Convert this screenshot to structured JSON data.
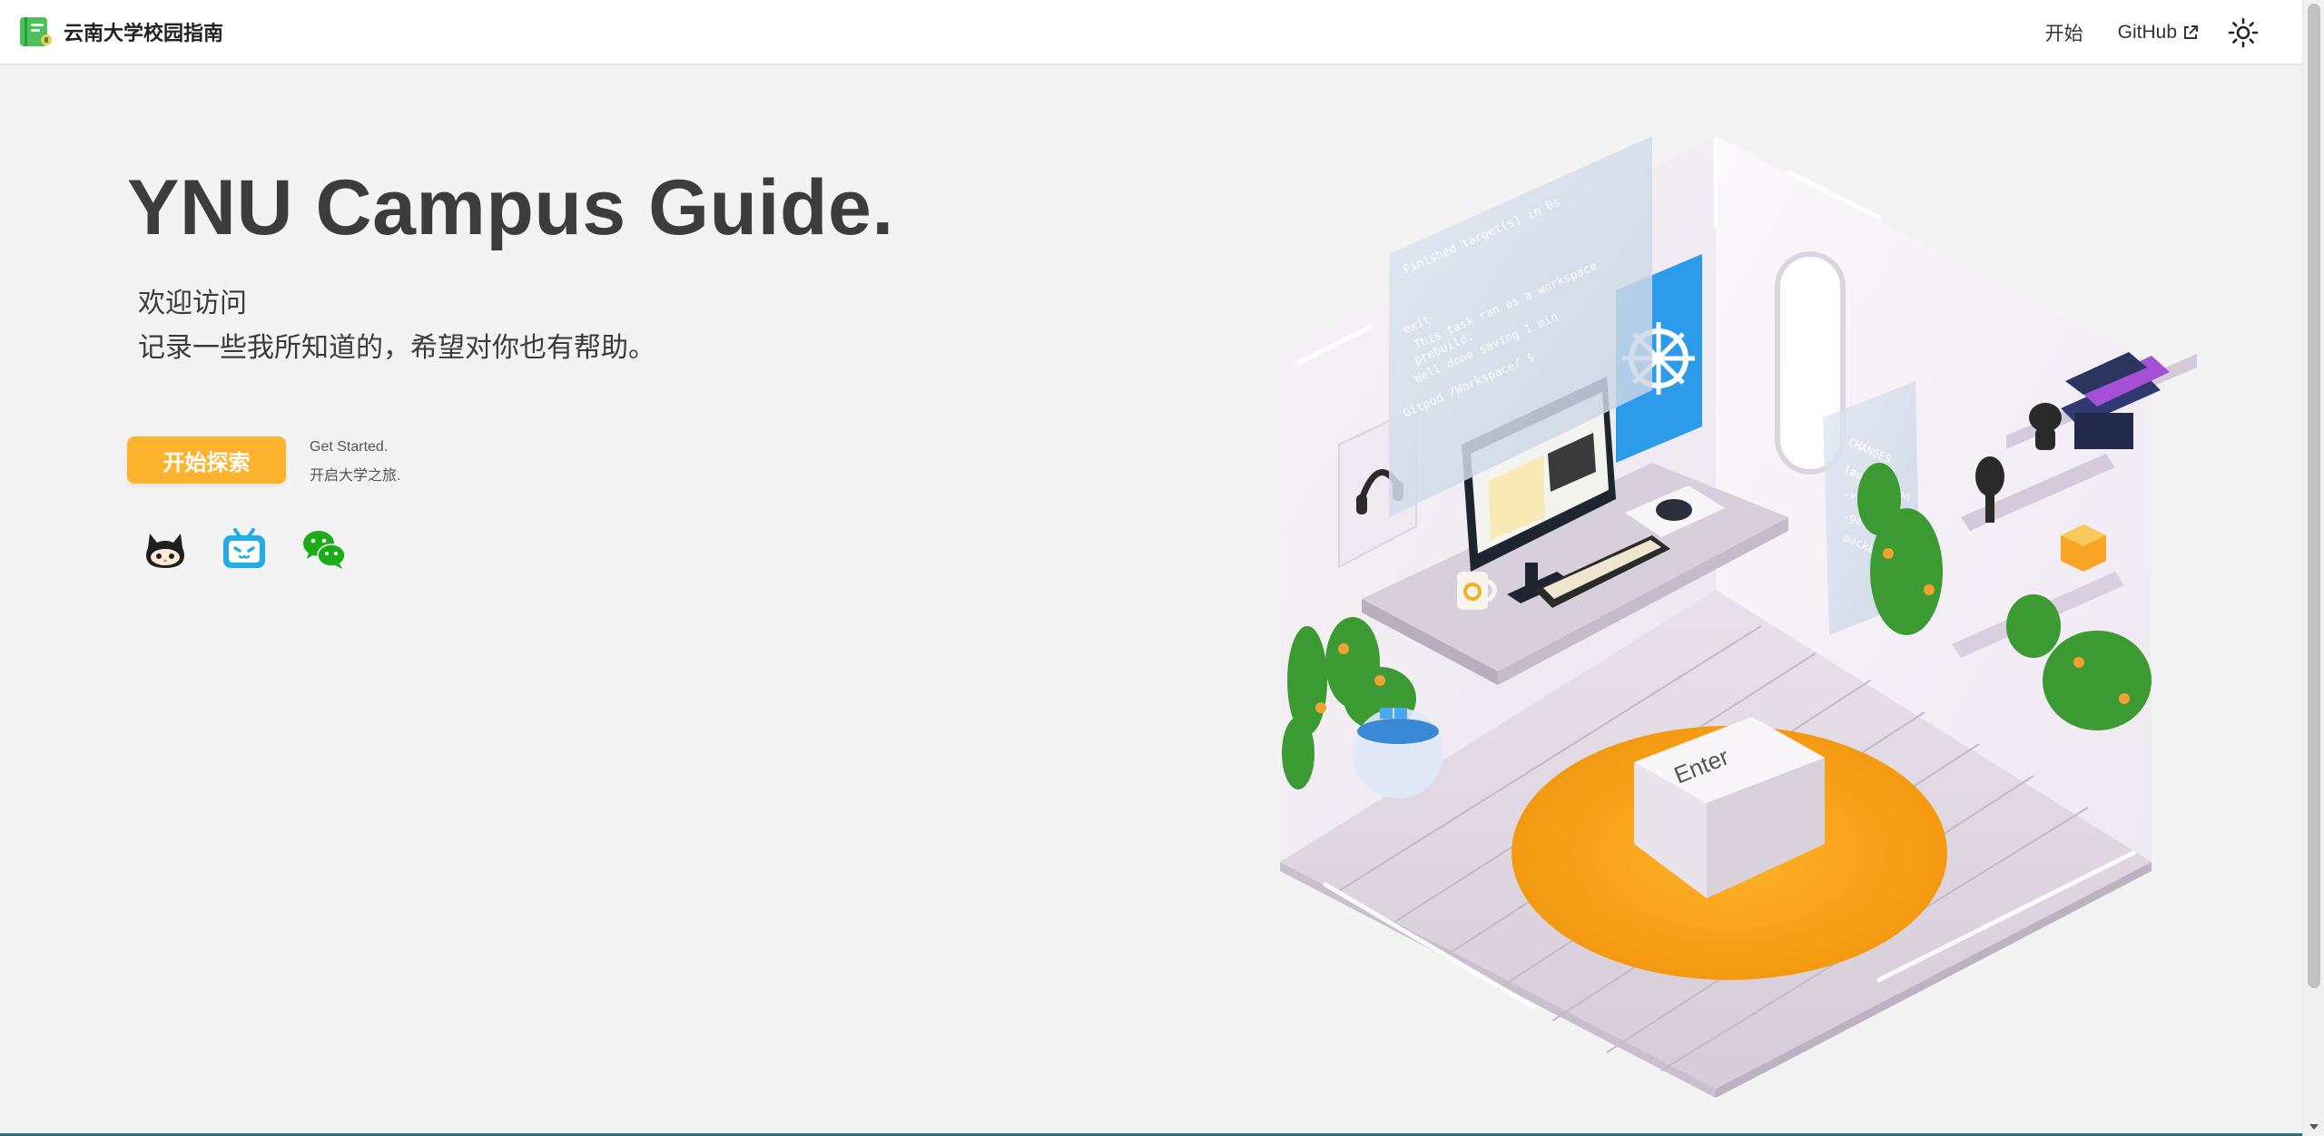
{
  "navbar": {
    "brand_title": "云南大学校园指南",
    "links": [
      {
        "label": "开始"
      },
      {
        "label": "GitHub"
      }
    ],
    "theme_toggle_icon": "sun-icon"
  },
  "hero": {
    "title": "YNU Campus Guide.",
    "subtitle_line1": "欢迎访问",
    "subtitle_line2": "记录一些我所知道的，希望对你也有帮助。",
    "start_button": "开始探索",
    "start_note_line1": "Get Started.",
    "start_note_line2": "开启大学之旅."
  },
  "social": [
    {
      "icon": "github-icon"
    },
    {
      "icon": "bilibili-icon"
    },
    {
      "icon": "wechat-icon"
    }
  ],
  "illustration": {
    "terminal_lines": [
      "Finished   target(s) in 0s",
      "exit",
      "This task ran as a workspace",
      "prebuild.",
      "Well done saving 1 min",
      "Gitpod /Workspace/ $"
    ],
    "side_panel_lines": [
      "CHANGES",
      "launch.json",
      ".vscode.ignore",
      ".gitpod.yml",
      "package.json"
    ],
    "key_label": "Enter"
  },
  "colors": {
    "accent": "#feb32e",
    "background": "#f4f3f3",
    "title": "#3c3c3c",
    "bilibili": "#23ade5",
    "wechat": "#1aad19"
  }
}
